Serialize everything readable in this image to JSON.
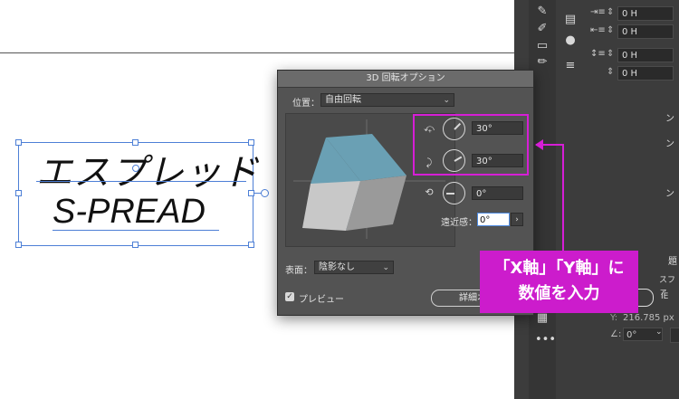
{
  "artboard": {
    "katakana_text": "エスプレッド",
    "latin_text": "S-PREAD"
  },
  "right_panel": {
    "rows": [
      {
        "value": "0 H"
      },
      {
        "value": "0 H"
      },
      {
        "value": "0 H"
      },
      {
        "value": "0 H"
      }
    ],
    "partial_texts": [
      "ン",
      "ン",
      "ン",
      "題",
      "スファ",
      "IE",
      "216.785 px",
      "0°"
    ],
    "y_label": "Y:",
    "y_value": "216.785 px",
    "angle_value": "0°",
    "more_label": "•••"
  },
  "dialog": {
    "title": "3D 回転オプション",
    "position_label": "位置：",
    "position_value": "自由回転",
    "x_value": "30°",
    "y_value": "30°",
    "z_value": "0°",
    "perspective_label": "遠近感：",
    "perspective_value": "0°",
    "surface_label": "表面：",
    "surface_value": "陰影なし",
    "preview_label": "プレビュー",
    "preview_checked": true,
    "advanced_button": "詳細オプシ"
  },
  "callout": {
    "line1": "「X軸」「Y軸」に",
    "line2": "数値を入力",
    "color": "#cc1ccc"
  },
  "cube_colors": {
    "top": "#6aa0b4",
    "left": "#c8c8c8",
    "right": "#9a9a9a"
  }
}
